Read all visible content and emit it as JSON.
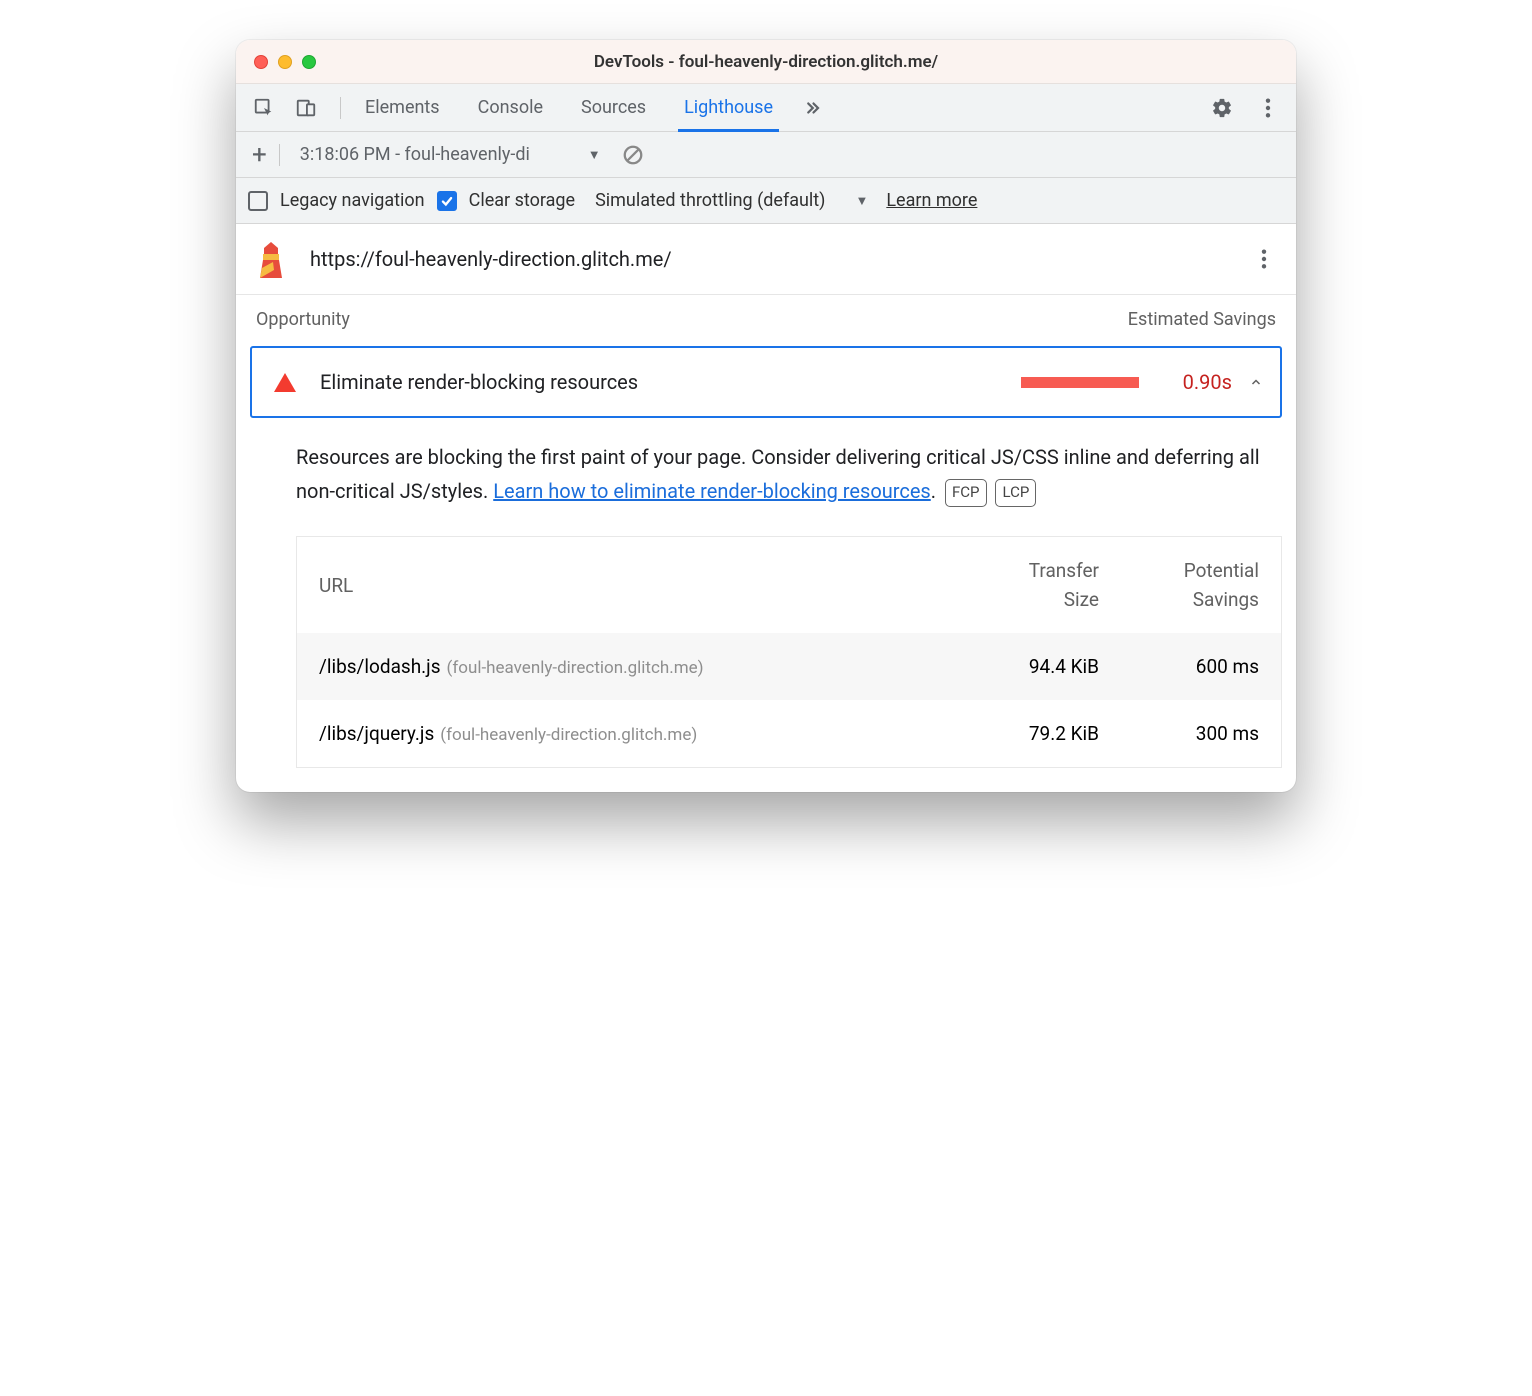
{
  "window": {
    "title": "DevTools - foul-heavenly-direction.glitch.me/"
  },
  "tabs": {
    "elements": "Elements",
    "console": "Console",
    "sources": "Sources",
    "lighthouse": "Lighthouse"
  },
  "subbar": {
    "report": "3:18:06 PM - foul-heavenly-di"
  },
  "config": {
    "legacy": "Legacy navigation",
    "clear": "Clear storage",
    "throttling": "Simulated throttling (default)",
    "learn": "Learn more"
  },
  "url": "https://foul-heavenly-direction.glitch.me/",
  "section": {
    "opportunity": "Opportunity",
    "estimated": "Estimated Savings"
  },
  "opp": {
    "title": "Eliminate render-blocking resources",
    "savings": "0.90s",
    "help1": "Resources are blocking the first paint of your page. Consider delivering critical JS/CSS inline and deferring all non-critical JS/styles. ",
    "help_link": "Learn how to eliminate render-blocking resources",
    "badge_fcp": "FCP",
    "badge_lcp": "LCP"
  },
  "table": {
    "col_url": "URL",
    "col_size_a": "Transfer",
    "col_size_b": "Size",
    "col_save_a": "Potential",
    "col_save_b": "Savings",
    "rows": [
      {
        "path": "/libs/lodash.js",
        "host": "(foul-heavenly-direction.glitch.me)",
        "size": "94.4 KiB",
        "save": "600 ms"
      },
      {
        "path": "/libs/jquery.js",
        "host": "(foul-heavenly-direction.glitch.me)",
        "size": "79.2 KiB",
        "save": "300 ms"
      }
    ]
  }
}
